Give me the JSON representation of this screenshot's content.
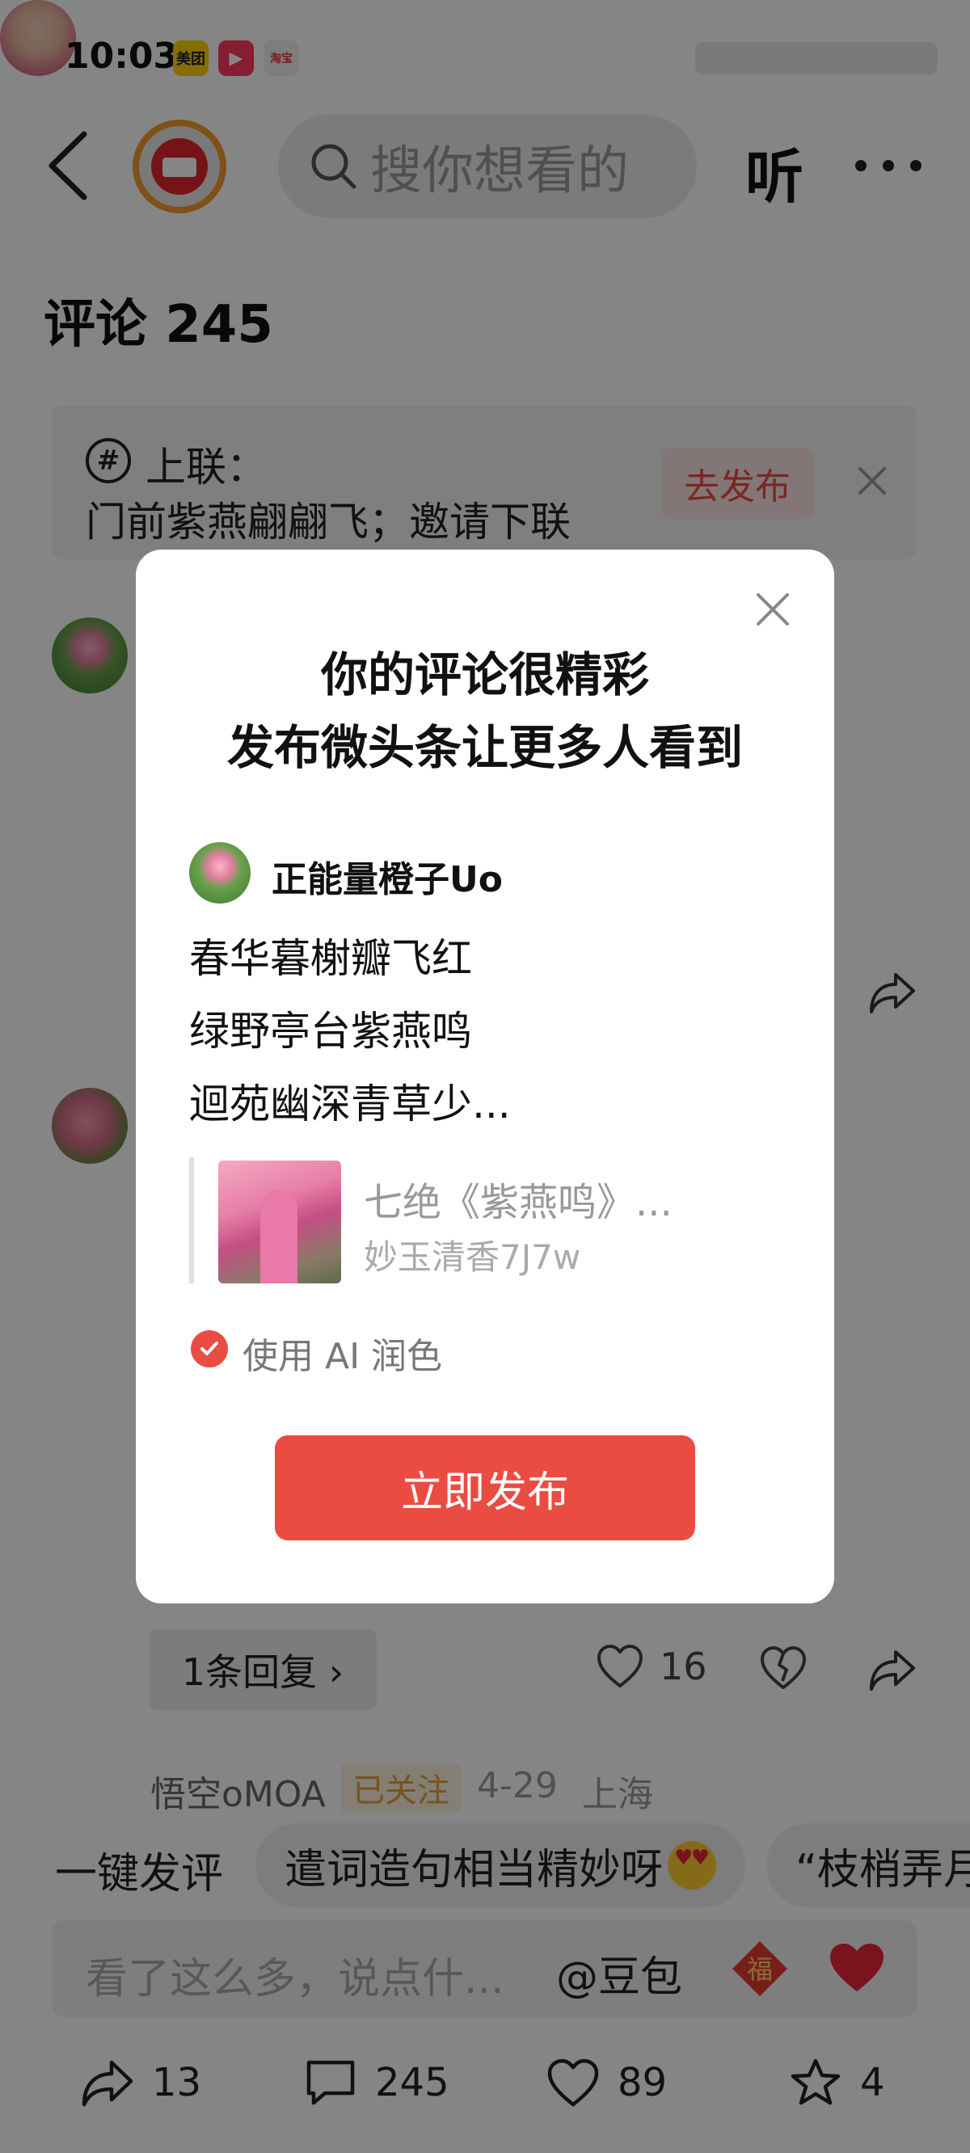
{
  "status_bar": {
    "time": "10:03",
    "app_icons": [
      "美团",
      "▶",
      "淘宝"
    ]
  },
  "header": {
    "search_placeholder": "搜你想看的",
    "listen_label": "听"
  },
  "comments": {
    "title": "评论 245"
  },
  "topic": {
    "label": "上联：",
    "text": "门前紫燕翩翩飞；邀请下联",
    "button": "去发布"
  },
  "comment_item": {
    "reply_button": "1条回复 ›",
    "like_count": "16"
  },
  "next_comment": {
    "name": "悟空oMOA",
    "badge": "已关注",
    "date": "4-29",
    "location": "上海"
  },
  "quick_comments": {
    "label": "一键发评",
    "chips": [
      "遣词造句相当精妙呀",
      "“枝梢弄月"
    ]
  },
  "input": {
    "placeholder": "看了这么多，说点什...",
    "mention": "@豆包"
  },
  "bottom_actions": {
    "share_count": "13",
    "comment_count": "245",
    "like_count": "89",
    "favorite_count": "4"
  },
  "modal": {
    "title_line1": "你的评论很精彩",
    "title_line2": "发布微头条让更多人看到",
    "author": "正能量橙子Uo",
    "poem_lines": [
      "春华暮榭瓣飞红",
      "绿野亭台紫燕鸣",
      "迴苑幽深青草少..."
    ],
    "ref_title": "七绝《紫燕鸣》...",
    "ref_author": "妙玉清香7J7w",
    "ai_label": "使用 AI 润色",
    "publish_button": "立即发布"
  },
  "colors": {
    "accent": "#ea4c42",
    "overlay": "rgba(0,0,0,0.48)"
  }
}
